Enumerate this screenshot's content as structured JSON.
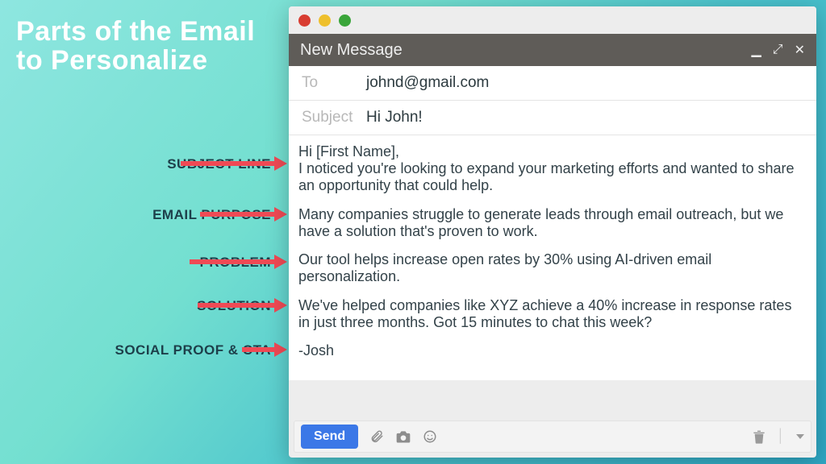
{
  "title_line1": "Parts of the Email",
  "title_line2": "to Personalize",
  "labels": {
    "subject": "SUBJECT LINE",
    "purpose": "EMAIL PURPOSE",
    "problem": "PROBLEM",
    "solution": "SOLUTION",
    "social": "SOCIAL PROOF & CTA"
  },
  "compose": {
    "window_title": "New Message",
    "to_label": "To",
    "to_value": "johnd@gmail.com",
    "subject_label": "Subject",
    "subject_value": "Hi John!",
    "greeting": "Hi [First Name],",
    "purpose": "I noticed you're looking to expand your marketing efforts and wanted to share an opportunity that could help.",
    "problem": "Many companies struggle to generate leads through email outreach, but we have a solution that's proven to work.",
    "solution": "Our tool helps increase open rates by 30% using AI-driven email personalization.",
    "social": "We've helped companies like XYZ achieve a 40% increase in response rates in just three months. Got 15 minutes to chat this week?",
    "signature": "-Josh",
    "send": "Send"
  }
}
